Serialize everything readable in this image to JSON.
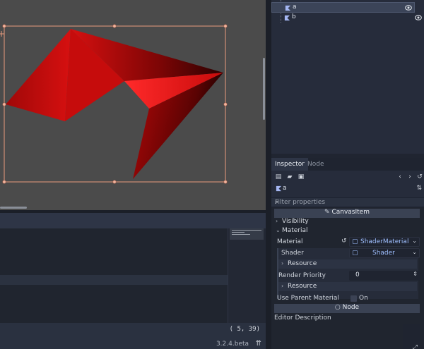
{
  "scene_tree": {
    "items": [
      {
        "label": "a",
        "selected": true
      },
      {
        "label": "b",
        "selected": false
      }
    ]
  },
  "inspector": {
    "tabs": [
      "Inspector",
      "Node"
    ],
    "object_name": "a",
    "filter_placeholder": "Filter properties",
    "category_canvasitem": "CanvasItem",
    "section_visibility": "Visibility",
    "section_material": "Material",
    "material_label": "Material",
    "material_value": "ShaderMaterial",
    "shader_label": "Shader",
    "shader_value": "Shader",
    "resource_label_1": "Resource",
    "render_priority_label": "Render Priority",
    "render_priority_value": "0",
    "resource_label_2": "Resource",
    "use_parent_material_label": "Use Parent Material",
    "use_parent_material_value": "On",
    "category_node": "Node",
    "editor_description_label": "Editor Description"
  },
  "status_bar": {
    "coords": "( 5, 39)",
    "version": "3.2.4.beta"
  },
  "colors": {
    "selection_rect": "#e89b7e",
    "polygon_red": "#c80b0b",
    "accent_blue": "#9fbfff"
  }
}
